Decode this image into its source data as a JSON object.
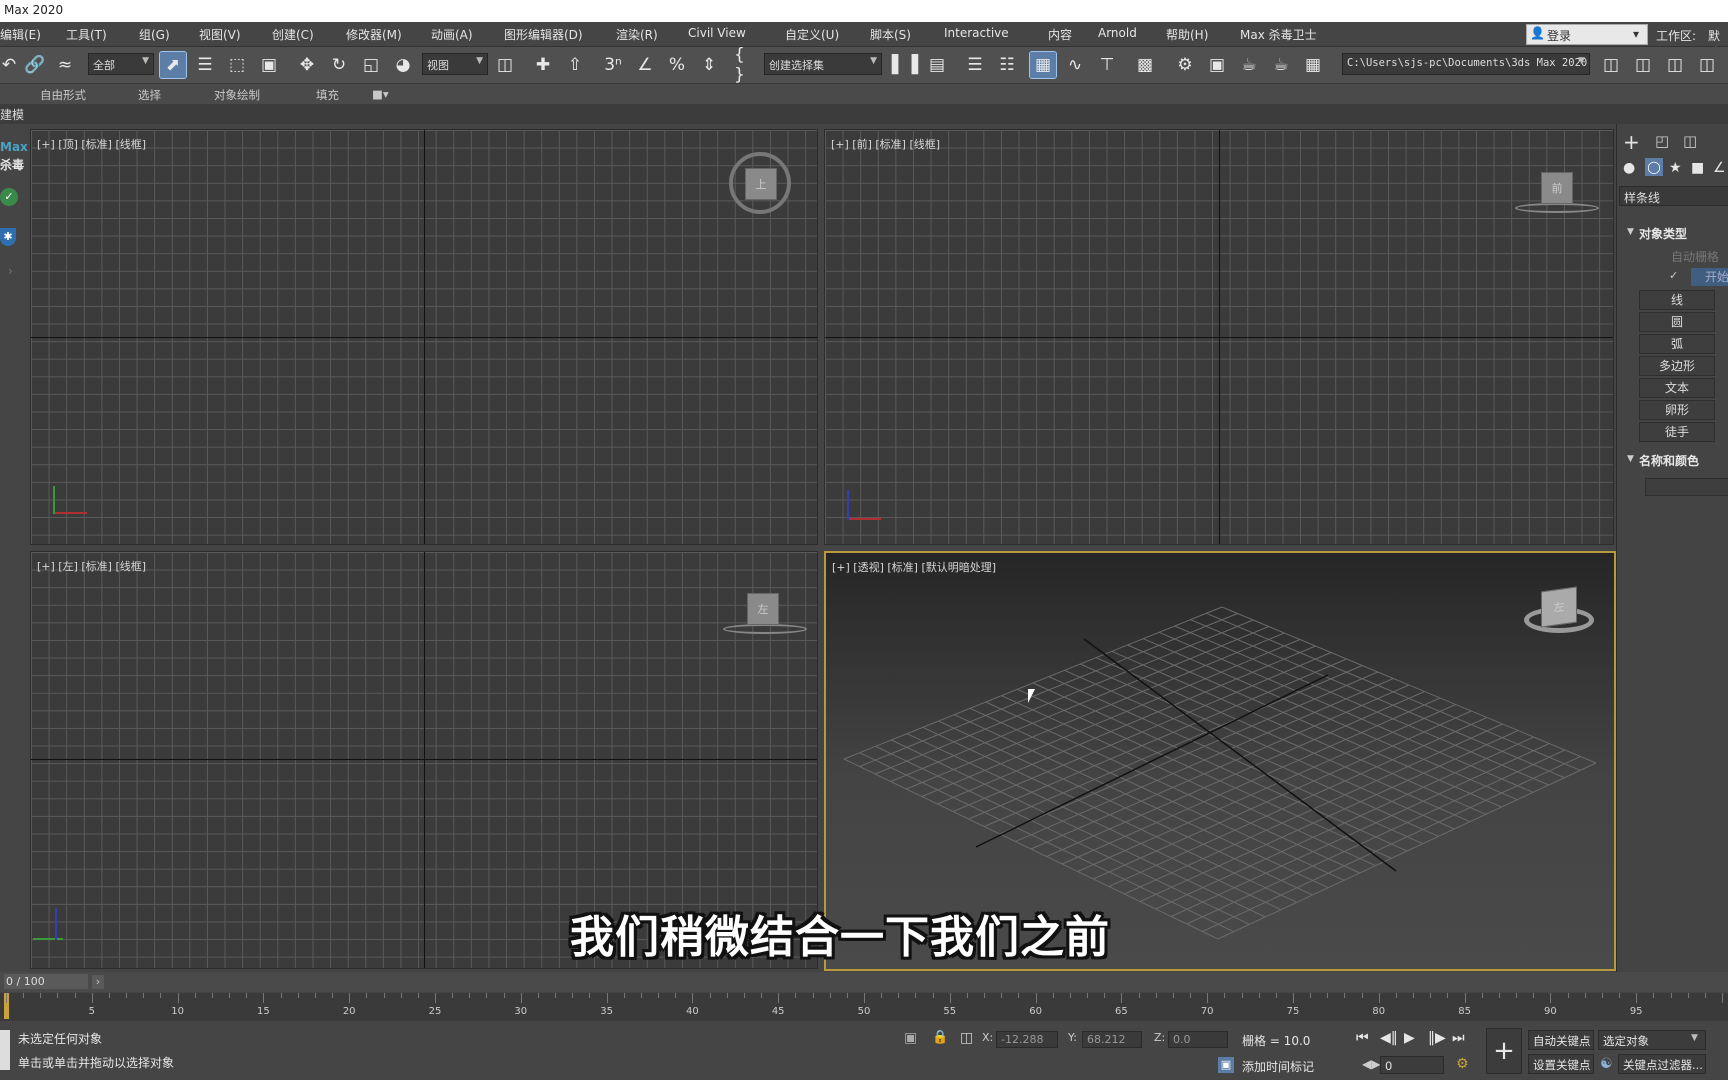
{
  "window": {
    "title": "Max 2020"
  },
  "menu": [
    {
      "label": "编辑(E)"
    },
    {
      "label": "工具(T)"
    },
    {
      "label": "组(G)"
    },
    {
      "label": "视图(V)"
    },
    {
      "label": "创建(C)"
    },
    {
      "label": "修改器(M)"
    },
    {
      "label": "动画(A)"
    },
    {
      "label": "图形编辑器(D)"
    },
    {
      "label": "渲染(R)"
    },
    {
      "label": "Civil View"
    },
    {
      "label": "自定义(U)"
    },
    {
      "label": "脚本(S)"
    },
    {
      "label": "Interactive"
    },
    {
      "label": "内容"
    },
    {
      "label": "Arnold"
    },
    {
      "label": "帮助(H)"
    },
    {
      "label": "Max 杀毒卫士"
    }
  ],
  "menubar_right": {
    "login": "登录",
    "workspace_label": "工作区:",
    "workspace_value": "默认"
  },
  "toolbar": {
    "selection_filter": "全部",
    "reference_coord": "视图",
    "named_selection": "创建选择集",
    "project_path": "C:\\Users\\sjs-pc\\Documents\\3ds Max 2020"
  },
  "ribbon_tabs": [
    {
      "label": "自由形式"
    },
    {
      "label": "选择"
    },
    {
      "label": "对象绘制"
    },
    {
      "label": "填充"
    }
  ],
  "modeling_label": "建模",
  "left_strip": {
    "brand_line1": "Max",
    "brand_line2": "杀毒"
  },
  "viewports": {
    "top": {
      "label": "[+] [顶] [标准] [线框]",
      "cube": "上"
    },
    "front": {
      "label": "[+] [前] [标准] [线框]",
      "cube": "前"
    },
    "left": {
      "label": "[+] [左] [标准] [线框]",
      "cube": "左"
    },
    "perspective": {
      "label": "[+] [透视] [标准] [默认明暗处理]",
      "cube": "左"
    }
  },
  "command_panel": {
    "category": "样条线",
    "section_object_type": "对象类型",
    "auto_grid": "自动栅格",
    "start_new_shape": "开始",
    "buttons": [
      {
        "label": "线"
      },
      {
        "label": "圆"
      },
      {
        "label": "弧"
      },
      {
        "label": "多边形"
      },
      {
        "label": "文本"
      },
      {
        "label": "卵形"
      },
      {
        "label": "徒手"
      }
    ],
    "section_name_color": "名称和颜色"
  },
  "timeline": {
    "slider_text": "0 / 100",
    "ticks": [
      5,
      10,
      15,
      20,
      25,
      30,
      35,
      40,
      45,
      50,
      55,
      60,
      65,
      70,
      75,
      80,
      85,
      90,
      95
    ],
    "range_max": 100
  },
  "status": {
    "line1": "未选定任何对象",
    "line2": "单击或单击并拖动以选择对象",
    "x_label": "X:",
    "x_value": "-12.288",
    "y_label": "Y:",
    "y_value": "68.212",
    "z_label": "Z:",
    "z_value": "0.0",
    "grid": "栅格 = 10.0",
    "add_time_tag": "添加时间标记",
    "auto_key": "自动关键点",
    "set_key": "设置关键点",
    "key_mode": "选定对象",
    "key_filters": "关键点过滤器...",
    "current_frame": "0"
  },
  "subtitle": "我们稍微结合一下我们之前",
  "colors": {
    "accent": "#5c7ea6",
    "active_viewport_border": "#b89a3c",
    "background": "#444444"
  }
}
